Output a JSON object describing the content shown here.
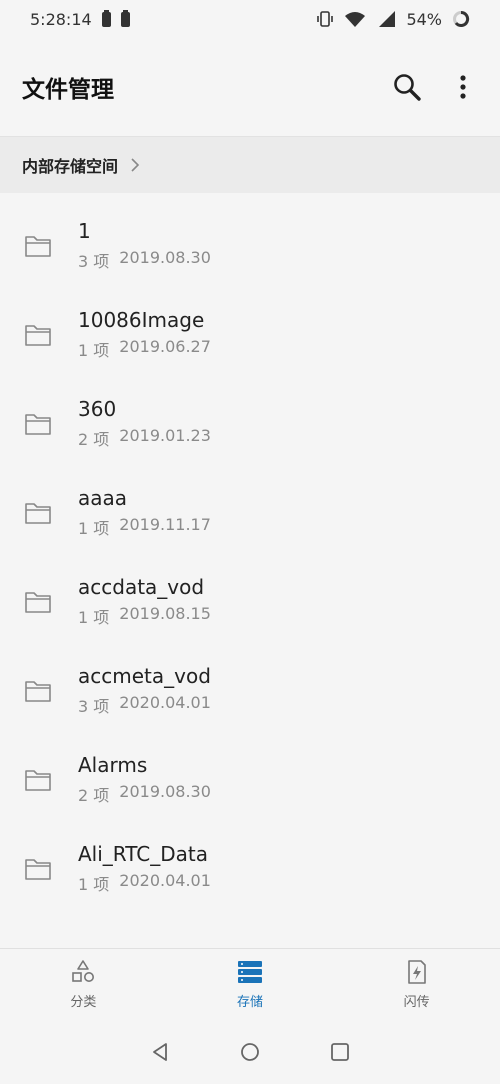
{
  "status_bar": {
    "time": "5:28:14",
    "battery_percent": "54%"
  },
  "app_bar": {
    "title": "文件管理",
    "search_icon": "search-icon",
    "more_icon": "more-vert-icon"
  },
  "breadcrumb": {
    "label": "内部存储空间",
    "chevron": "›"
  },
  "files": [
    {
      "name": "1",
      "count": "3 项",
      "date": "2019.08.30"
    },
    {
      "name": "10086Image",
      "count": "1 项",
      "date": "2019.06.27"
    },
    {
      "name": "360",
      "count": "2 项",
      "date": "2019.01.23"
    },
    {
      "name": "aaaa",
      "count": "1 项",
      "date": "2019.11.17"
    },
    {
      "name": "accdata_vod",
      "count": "1 项",
      "date": "2019.08.15"
    },
    {
      "name": "accmeta_vod",
      "count": "3 项",
      "date": "2020.04.01"
    },
    {
      "name": "Alarms",
      "count": "2 项",
      "date": "2019.08.30"
    },
    {
      "name": "Ali_RTC_Data",
      "count": "1 项",
      "date": "2020.04.01"
    }
  ],
  "bottom_nav": [
    {
      "label": "分类",
      "icon": "category-icon",
      "active": false
    },
    {
      "label": "存储",
      "icon": "storage-icon",
      "active": true
    },
    {
      "label": "闪传",
      "icon": "flash-transfer-icon",
      "active": false
    }
  ],
  "colors": {
    "accent": "#1a73b8",
    "background": "#f5f5f5",
    "breadcrumb_bg": "#ebebeb"
  }
}
